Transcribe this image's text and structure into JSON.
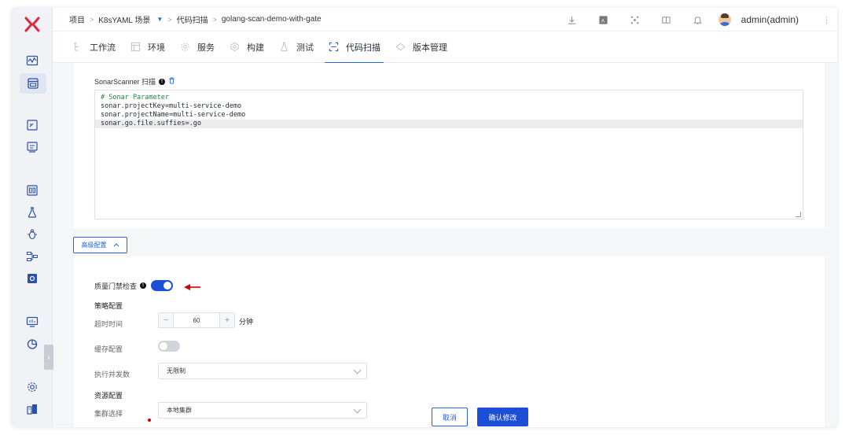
{
  "brand": {
    "logo_color": "#e2263a",
    "accent": "#1d4ed8"
  },
  "breadcrumb": {
    "items": [
      "项目",
      "K8sYAML 场景",
      "代码扫描",
      "golang-scan-demo-with-gate"
    ],
    "separator": ">",
    "dropdown_caret": "▼"
  },
  "topbar": {
    "icons": [
      "download-icon",
      "translate-icon",
      "plugin-icon",
      "book-icon",
      "bell-icon"
    ],
    "user_name": "admin(admin)",
    "more": "⋮"
  },
  "tabs": [
    {
      "label": "工作流",
      "icon": "workflow-icon"
    },
    {
      "label": "环境",
      "icon": "environment-icon"
    },
    {
      "label": "服务",
      "icon": "service-icon"
    },
    {
      "label": "构建",
      "icon": "build-icon"
    },
    {
      "label": "测试",
      "icon": "test-icon"
    },
    {
      "label": "代码扫描",
      "icon": "scan-icon",
      "active": true
    },
    {
      "label": "版本管理",
      "icon": "version-icon"
    }
  ],
  "sonar": {
    "label": "SonarScanner 扫描",
    "info": "!",
    "code_lines": [
      "# Sonar Parameter",
      "sonar.projectKey=multi-service-demo",
      "sonar.projectName=multi-service-demo",
      "sonar.go.file.suffies=.go"
    ]
  },
  "advanced": {
    "label": "高级配置",
    "chevron": "^"
  },
  "settings": {
    "quality_gate_label": "质量门禁检查",
    "quality_gate_on": true,
    "strategy_title": "策略配置",
    "timeout_label": "超时时间",
    "timeout_value": "60",
    "timeout_unit": "分钟",
    "minus": "−",
    "plus": "+",
    "cache_label": "缓存配置",
    "cache_on": false,
    "concurrency_label": "执行并发数",
    "concurrency_value": "无限制",
    "resource_title": "资源配置",
    "cluster_label": "集群选择",
    "cluster_value": "本地集群"
  },
  "footer": {
    "cancel": "取消",
    "confirm": "确认修改"
  },
  "colors": {
    "arrow": "#d00000",
    "toggle_on": "#1d4ed8",
    "toggle_off": "#d1d5db"
  }
}
